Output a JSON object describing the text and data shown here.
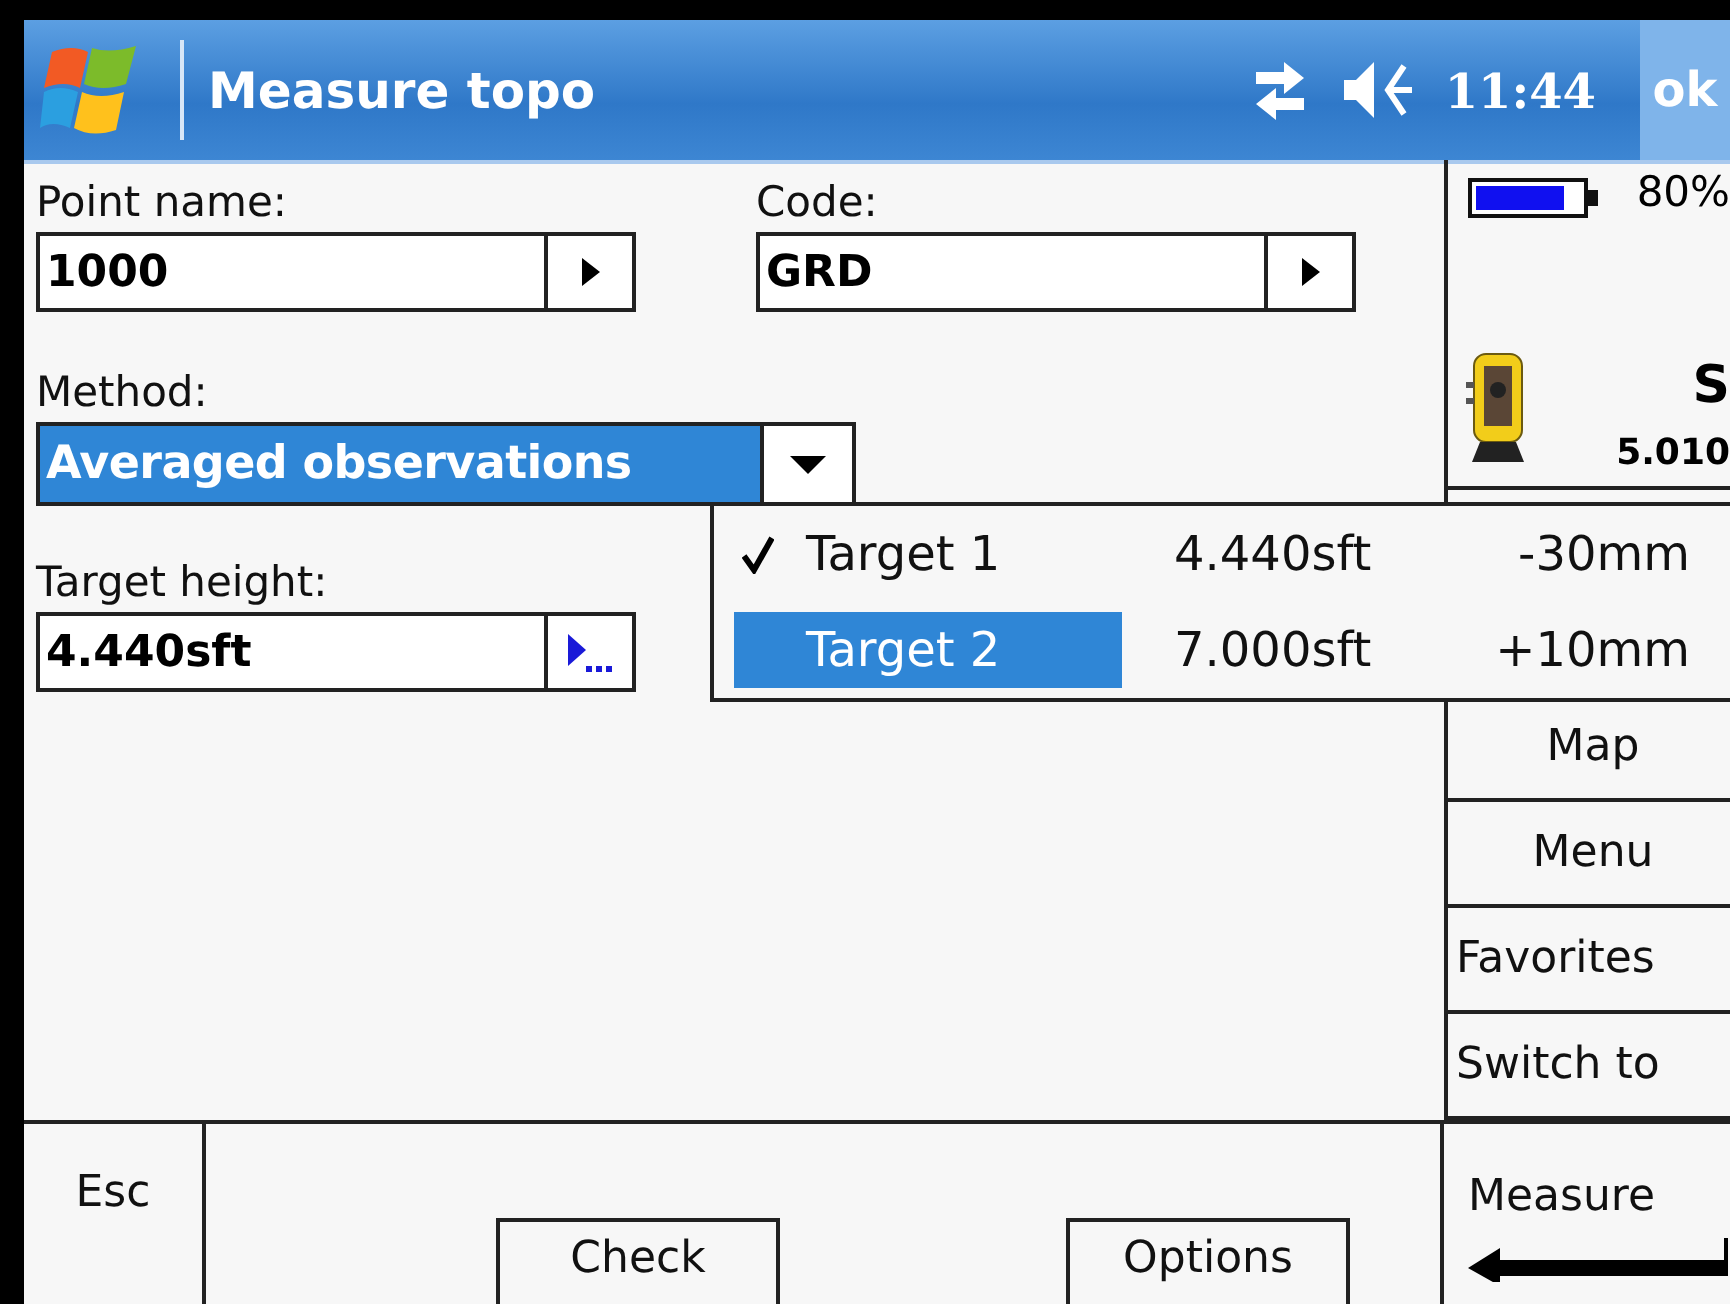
{
  "window": {
    "title": "Measure topo",
    "time": "11:44",
    "ok": "ok"
  },
  "fields": [
    {
      "label": "Point name:",
      "value": "1000",
      "kind": "arrow"
    },
    {
      "label": "Code:",
      "value": "GRD",
      "kind": "arrow"
    },
    {
      "label": "Method:",
      "value": "Averaged observations",
      "kind": "dropdown"
    },
    {
      "label": "Target height:",
      "value": "4.440sft",
      "kind": "more"
    }
  ],
  "status": {
    "battery": "80%",
    "instrument_name": "S",
    "instrument_value": "5.010"
  },
  "target_menu": [
    {
      "name": "Target 1",
      "height": "4.440sft",
      "offset": "-30mm",
      "checked": true,
      "selected": false
    },
    {
      "name": "Target 2",
      "height": "7.000sft",
      "offset": "+10mm",
      "checked": false,
      "selected": true
    }
  ],
  "side_buttons": [
    "Map",
    "Menu",
    "Favorites",
    "Switch to"
  ],
  "bottom": {
    "esc": "Esc",
    "buttons": [
      "Check",
      "Options"
    ],
    "measure": "Measure"
  }
}
